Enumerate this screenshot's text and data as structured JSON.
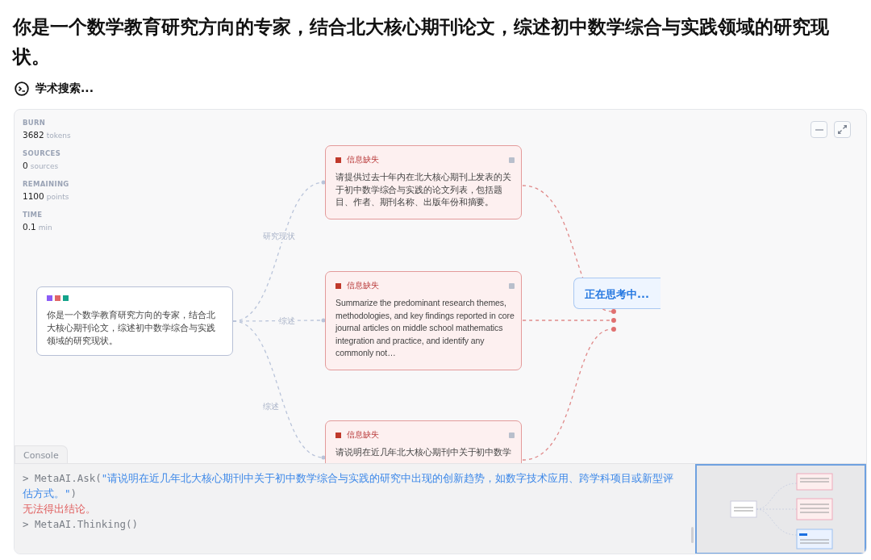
{
  "question": "你是一个数学教育研究方向的专家，结合北大核心期刊论文，综述初中数学综合与实践领域的研究现状。",
  "status": {
    "label": "学术搜索..."
  },
  "stats": [
    {
      "label": "BURN",
      "value": "3682",
      "unit": "tokens"
    },
    {
      "label": "SOURCES",
      "value": "0",
      "unit": "sources"
    },
    {
      "label": "REMAINING",
      "value": "1100",
      "unit": "points"
    },
    {
      "label": "TIME",
      "value": "0.1",
      "unit": "min"
    }
  ],
  "root_node": {
    "dots": [
      {
        "color": "#8b5cf6"
      },
      {
        "color": "#e06666"
      },
      {
        "color": "#14a38b"
      }
    ],
    "text": "你是一个数学教育研究方向的专家，结合北大核心期刊论文，综述初中数学综合与实践领域的研究现状。"
  },
  "branches": [
    {
      "label": "研究现状",
      "card": {
        "tag": "信息缺失",
        "text": "请提供过去十年内在北大核心期刊上发表的关于初中数学综合与实践的论文列表，包括题目、作者、期刊名称、出版年份和摘要。"
      }
    },
    {
      "label": "综述",
      "card": {
        "tag": "信息缺失",
        "text": "Summarize the predominant research themes, methodologies, and key findings reported in core journal articles on middle school mathematics integration and practice, and identify any commonly not…"
      }
    },
    {
      "label": "综述",
      "card": {
        "tag": "信息缺失",
        "text": "请说明在近几年北大核心期刊中关于初中数学"
      }
    }
  ],
  "thinking_node": {
    "text": "正在思考中..."
  },
  "console": {
    "tab": {
      "label": "Console",
      "selected": true
    },
    "lines": [
      {
        "kind": "call",
        "text": "> MetaAI.Ask(",
        "arg": "\"请说明在近几年北大核心期刊中关于初中数学综合与实践的研究中出现的创新趋势，如数字技术应用、跨学科项目或新型评估方式。\"",
        "tail": ")"
      },
      {
        "kind": "error",
        "text": "无法得出结论。"
      },
      {
        "kind": "call",
        "text": "> MetaAI.Thinking()"
      }
    ]
  }
}
